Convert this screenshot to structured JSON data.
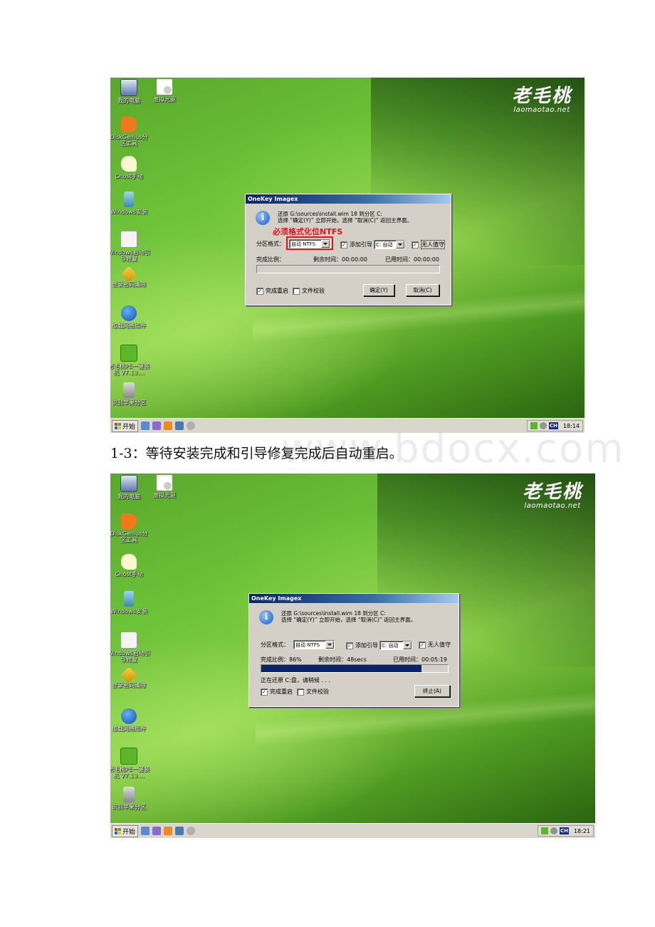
{
  "caption": "1-3：等待安装完成和引导修复完成后自动重启。",
  "watermark": "www.bdocx.com",
  "desktop": {
    "logo_cn": "老毛桃",
    "logo_en": "laomaotao.net",
    "icons": [
      {
        "label": "我的电脑",
        "icon": "computer-icon"
      },
      {
        "label": "虚拟光驱",
        "icon": "virtual-drive-icon"
      },
      {
        "label": "DiskGenius分区工具",
        "icon": "diskgenius-icon"
      },
      {
        "label": "Ghost手动",
        "icon": "ghost-icon"
      },
      {
        "label": "Windows安装",
        "icon": "windows-install-icon"
      },
      {
        "label": "Windows启动引导修复",
        "icon": "repair-kit-icon"
      },
      {
        "label": "登录密码清除",
        "icon": "key-icon"
      },
      {
        "label": "加载网络组件",
        "icon": "globe-icon"
      },
      {
        "label": "老毛桃PE一键装机 V7.13....",
        "icon": "laomaotao-installer-icon"
      },
      {
        "label": "识别苹果分区",
        "icon": "disk-drive-icon"
      }
    ]
  },
  "taskbar": {
    "start_label": "开始",
    "ime_label": "CH"
  },
  "screens": [
    {
      "clock": "18:14",
      "dialog": {
        "title": "OneKey Imagex",
        "message_line1": "还原 G:\\sources\\install.wim 18 到分区 C:",
        "message_line2": "选择 “确定(Y)” 立即开始，选择 “取消(C)” 返回主界面。",
        "partition_format_label": "分区格式：",
        "partition_format_value": "自动 NTFS",
        "add_boot_label": "添加引导",
        "add_boot_checked": true,
        "boot_drive_value": "C: 自动",
        "unattended_label": "无人值守",
        "unattended_checked": true,
        "progress_label": "完成比例：",
        "progress_value": "",
        "progress_percent": 0,
        "remaining_label": "剩余时间：",
        "remaining_value": "00:00:00",
        "elapsed_label": "已用时间：",
        "elapsed_value": "00:00:00",
        "status_text": "",
        "reboot_label": "完成重启",
        "reboot_checked": true,
        "verify_label": "文件校验",
        "verify_checked": false,
        "ok_button": "确定(Y)",
        "cancel_button": "取消(C)"
      },
      "annotation": "必须格式化位NTFS"
    },
    {
      "clock": "18:21",
      "dialog": {
        "title": "OneKey Imagex",
        "message_line1": "还原 G:\\sources\\install.wim 18 到分区 C:",
        "message_line2": "选择 “确定(Y)” 立即开始，选择 “取消(C)” 返回主界面。",
        "partition_format_label": "分区格式：",
        "partition_format_value": "自动 NTFS",
        "add_boot_label": "添加引导",
        "add_boot_checked": true,
        "boot_drive_value": "C: 自动",
        "unattended_label": "无人值守",
        "unattended_checked": true,
        "progress_label": "完成比例：",
        "progress_value": "86%",
        "progress_percent": 86,
        "remaining_label": "剩余时间：",
        "remaining_value": "48secs",
        "elapsed_label": "已用时间：",
        "elapsed_value": "00:05:19",
        "status_text": "正在还原 C:盘，请稍候 . . .",
        "reboot_label": "完成重启",
        "reboot_checked": true,
        "verify_label": "文件校验",
        "verify_checked": false,
        "abort_button": "终止(A)"
      }
    }
  ],
  "colors": {
    "annotation_red": "#e8101a",
    "progress_fill": "#0a246a",
    "titlebar": "#0a246a"
  }
}
